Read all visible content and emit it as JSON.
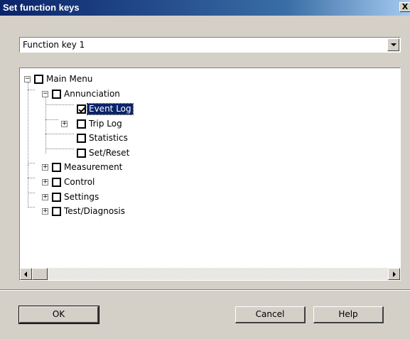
{
  "window": {
    "title": "Set function keys",
    "close_label": "X"
  },
  "combo": {
    "value": "Function key 1"
  },
  "tree": {
    "main_menu": "Main Menu",
    "annunciation": "Annunciation",
    "event_log": "Event Log",
    "trip_log": "Trip Log",
    "statistics": "Statistics",
    "set_reset": "Set/Reset",
    "measurement": "Measurement",
    "control": "Control",
    "settings": "Settings",
    "test_diagnosis": "Test/Diagnosis",
    "expand_symbol": "+",
    "collapse_symbol": "−"
  },
  "buttons": {
    "ok": "OK",
    "cancel": "Cancel",
    "help": "Help"
  }
}
